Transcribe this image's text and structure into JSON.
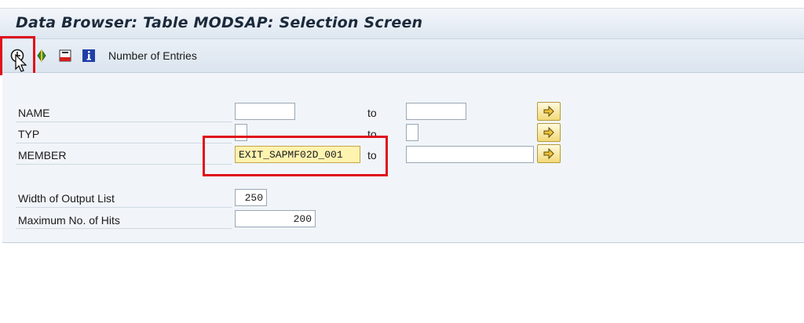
{
  "window": {
    "title": "Data Browser: Table MODSAP: Selection Screen"
  },
  "toolbar": {
    "execute_icon": "clock-execute-icon",
    "number_of_entries_label": "Number of Entries"
  },
  "selection": {
    "rows": [
      {
        "label": "NAME",
        "from": "",
        "to_label": "to",
        "to": ""
      },
      {
        "label": "TYP",
        "from": "",
        "to_label": "to",
        "to": ""
      },
      {
        "label": "MEMBER",
        "from": "EXIT_SAPMF02D_001",
        "to_label": "to",
        "to": ""
      }
    ]
  },
  "output": {
    "width_label": "Width of Output List",
    "width_value": "250",
    "max_hits_label": "Maximum No. of Hits",
    "max_hits_value": "200"
  },
  "colors": {
    "highlight_box": "#e0101a",
    "active_field": "#fff3b0"
  }
}
